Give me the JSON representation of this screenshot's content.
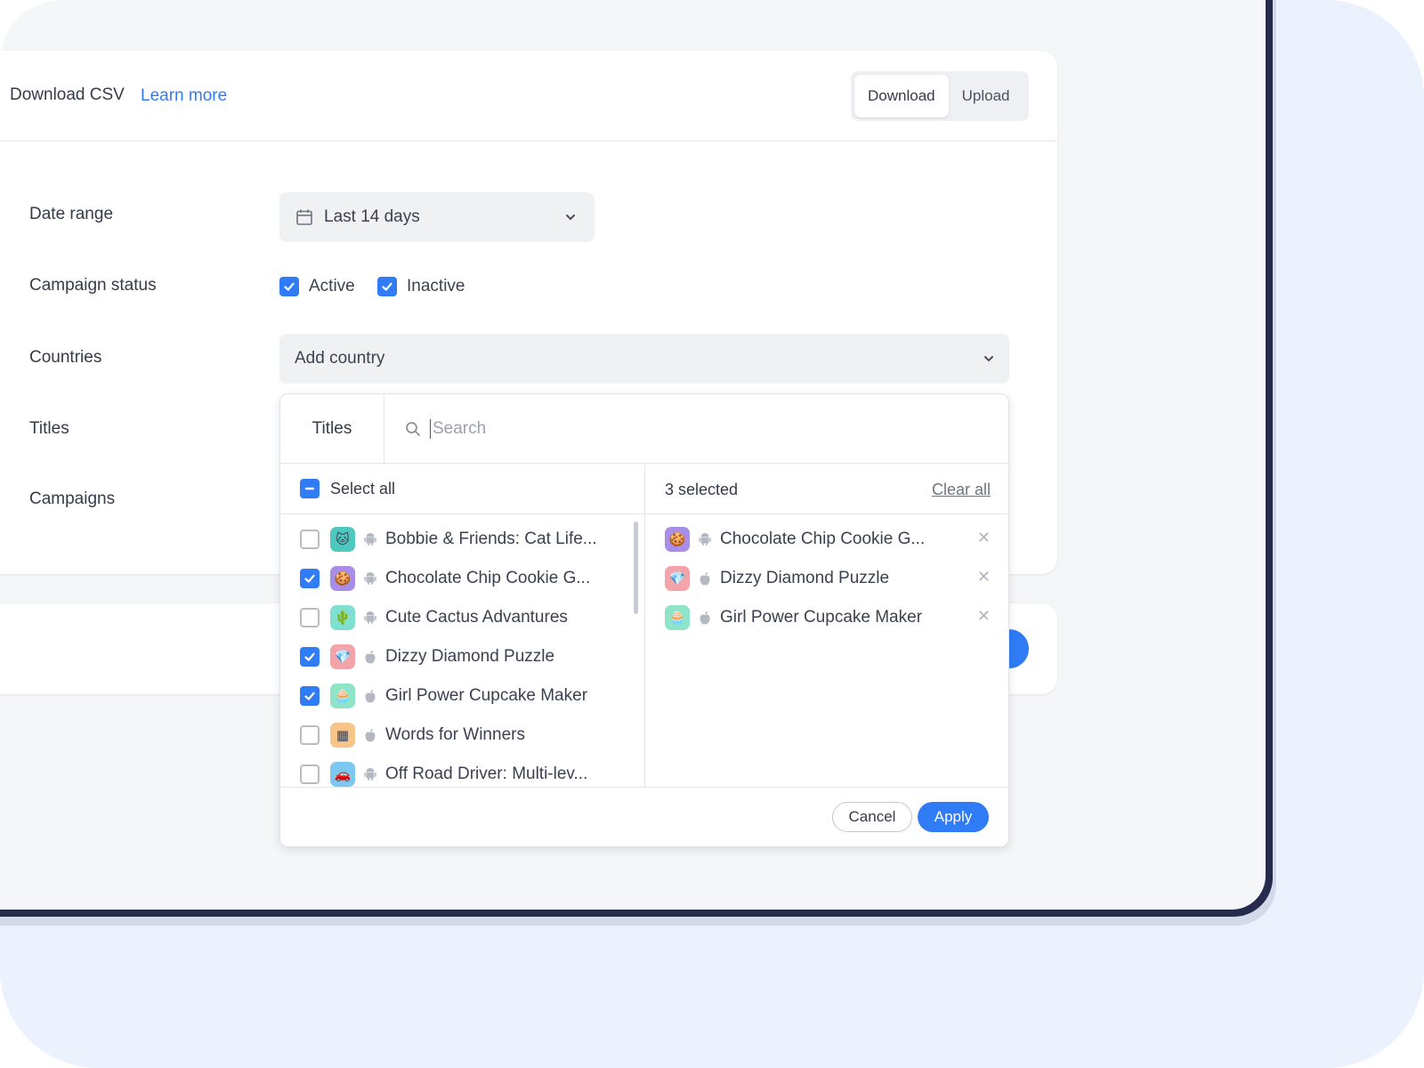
{
  "header": {
    "title": "Download CSV",
    "learn_more": "Learn more",
    "tabs": [
      "Download",
      "Upload"
    ]
  },
  "form": {
    "date_label": "Date range",
    "date_value": "Last 14 days",
    "status_label": "Campaign status",
    "status_options": [
      "Active",
      "Inactive"
    ],
    "countries_label": "Countries",
    "countries_placeholder": "Add country",
    "titles_label": "Titles",
    "campaigns_label": "Campaigns"
  },
  "popup": {
    "tab": "Titles",
    "search_placeholder": "Search",
    "select_all": "Select all",
    "selected_count": "3 selected",
    "clear_all": "Clear all",
    "items": [
      {
        "name": "Bobbie & Friends: Cat Life...",
        "checked": false,
        "platform": "android-icon",
        "icon": "cat-app-icon"
      },
      {
        "name": "Chocolate Chip Cookie G...",
        "checked": true,
        "platform": "android-icon",
        "icon": "cookie-app-icon"
      },
      {
        "name": "Cute Cactus Advantures",
        "checked": false,
        "platform": "android-icon",
        "icon": "cactus-app-icon"
      },
      {
        "name": "Dizzy Diamond Puzzle",
        "checked": true,
        "platform": "apple-icon",
        "icon": "diamond-app-icon"
      },
      {
        "name": "Girl Power Cupcake Maker",
        "checked": true,
        "platform": "apple-icon",
        "icon": "cupcake-app-icon"
      },
      {
        "name": "Words for Winners",
        "checked": false,
        "platform": "apple-icon",
        "icon": "words-app-icon"
      },
      {
        "name": "Off Road Driver: Multi-lev...",
        "checked": false,
        "platform": "android-icon",
        "icon": "car-app-icon"
      }
    ],
    "selected": [
      {
        "name": "Chocolate Chip Cookie G...",
        "platform": "android-icon",
        "icon": "cookie-app-icon"
      },
      {
        "name": "Dizzy Diamond Puzzle",
        "platform": "apple-icon",
        "icon": "diamond-app-icon"
      },
      {
        "name": "Girl Power Cupcake Maker",
        "platform": "apple-icon",
        "icon": "cupcake-app-icon"
      }
    ],
    "cancel": "Cancel",
    "apply": "Apply"
  },
  "colors": {
    "accent": "#2f7cf6",
    "frame": "#242b4d",
    "outer_bg": "#ecf2fd"
  }
}
